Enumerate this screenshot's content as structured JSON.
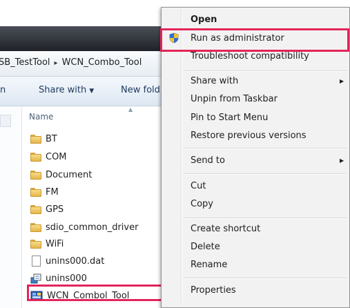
{
  "address_bar": {
    "crumb_1": "SB_TestTool",
    "crumb_2": "WCN_Combo_Tool",
    "separator": "▸"
  },
  "toolbar": {
    "left_fragment": "n",
    "share_with": "Share with",
    "new_folder": "New fold"
  },
  "file_list": {
    "column_name": "Name",
    "items": [
      {
        "name": "BT",
        "icon": "folder-icon"
      },
      {
        "name": "COM",
        "icon": "folder-icon"
      },
      {
        "name": "Document",
        "icon": "folder-icon"
      },
      {
        "name": "FM",
        "icon": "folder-icon"
      },
      {
        "name": "GPS",
        "icon": "folder-icon"
      },
      {
        "name": "sdio_common_driver",
        "icon": "folder-icon"
      },
      {
        "name": "WiFi",
        "icon": "folder-icon"
      },
      {
        "name": "unins000.dat",
        "icon": "file-icon"
      },
      {
        "name": "unins000",
        "icon": "setup-icon"
      },
      {
        "name": "WCN_Combol_Tool",
        "icon": "app-icon"
      }
    ]
  },
  "context_menu": {
    "open": "Open",
    "run_as_admin": "Run as administrator",
    "troubleshoot": "Troubleshoot compatibility",
    "share_with": "Share with",
    "unpin_taskbar": "Unpin from Taskbar",
    "pin_start": "Pin to Start Menu",
    "restore_versions": "Restore previous versions",
    "send_to": "Send to",
    "cut": "Cut",
    "copy": "Copy",
    "create_shortcut": "Create shortcut",
    "delete": "Delete",
    "rename": "Rename",
    "properties": "Properties"
  },
  "colors": {
    "highlight": "#e3245a",
    "menu_bg": "#f2f2f2",
    "toolbar_text": "#1e3a5f"
  }
}
